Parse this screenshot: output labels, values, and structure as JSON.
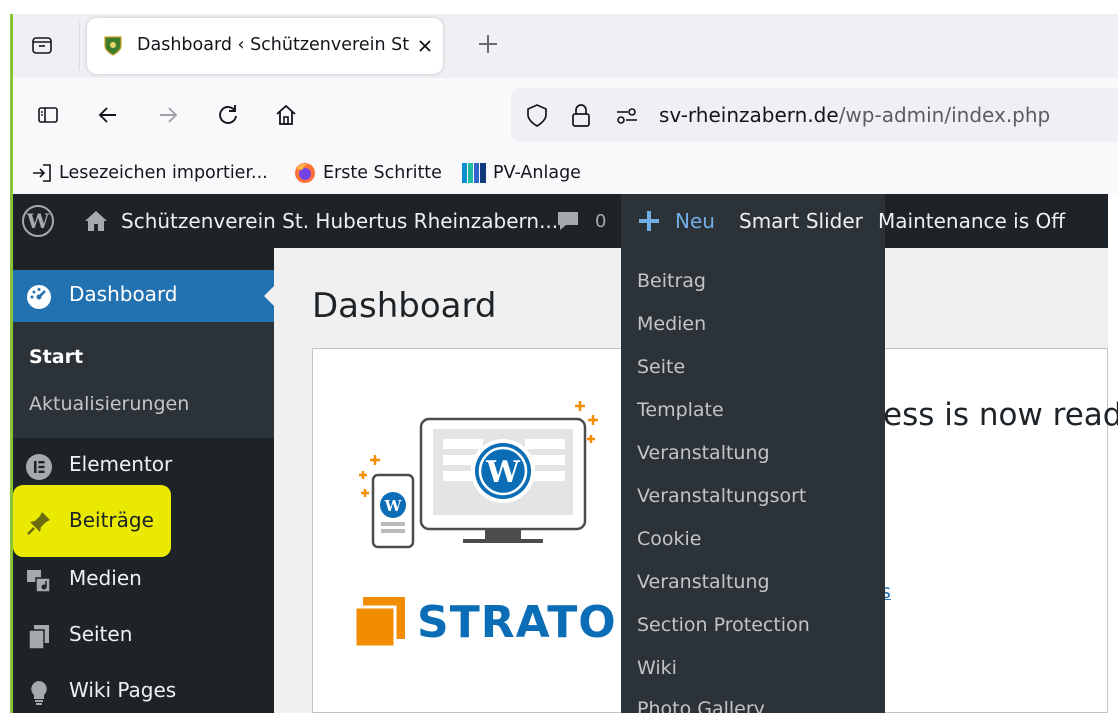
{
  "browser": {
    "tab_title": "Dashboard ‹ Schützenverein St.",
    "url_host": "sv-rheinzabern.de",
    "url_path": "/wp-admin/index.php",
    "bookmarks": [
      {
        "label": "Lesezeichen importier...",
        "icon": "import-icon"
      },
      {
        "label": "Erste Schritte",
        "icon": "firefox-icon"
      },
      {
        "label": "PV-Anlage",
        "icon": "pv-icon"
      }
    ]
  },
  "adminbar": {
    "site_name": "Schützenverein St. Hubertus Rheinzabern...",
    "comments_count": "0",
    "new_label": "Neu",
    "smart_slider": "Smart Slider",
    "maintenance": "Maintenance is Off"
  },
  "sidebar": {
    "dashboard": "Dashboard",
    "sub_start": "Start",
    "sub_updates": "Aktualisierungen",
    "elementor": "Elementor",
    "beitraege": "Beiträge",
    "medien": "Medien",
    "seiten": "Seiten",
    "wiki_pages": "Wiki Pages"
  },
  "main": {
    "page_title": "Dashboard",
    "welcome_fragment": "ess is now read",
    "link_fragment": "s",
    "strato_logo": "STRATO"
  },
  "new_menu": {
    "items": [
      "Beitrag",
      "Medien",
      "Seite",
      "Template",
      "Veranstaltung",
      "Veranstaltungsort",
      "Cookie",
      "Veranstaltung",
      "Section Protection",
      "Wiki",
      "Photo Gallery"
    ]
  },
  "colors": {
    "wp_dark": "#1d2327",
    "wp_submenu": "#2c3338",
    "wp_blue": "#2271b1",
    "wp_blue_light": "#72aee6",
    "highlight": "#f4f400",
    "strato_orange": "#f28c00",
    "strato_blue": "#0a6db5"
  }
}
